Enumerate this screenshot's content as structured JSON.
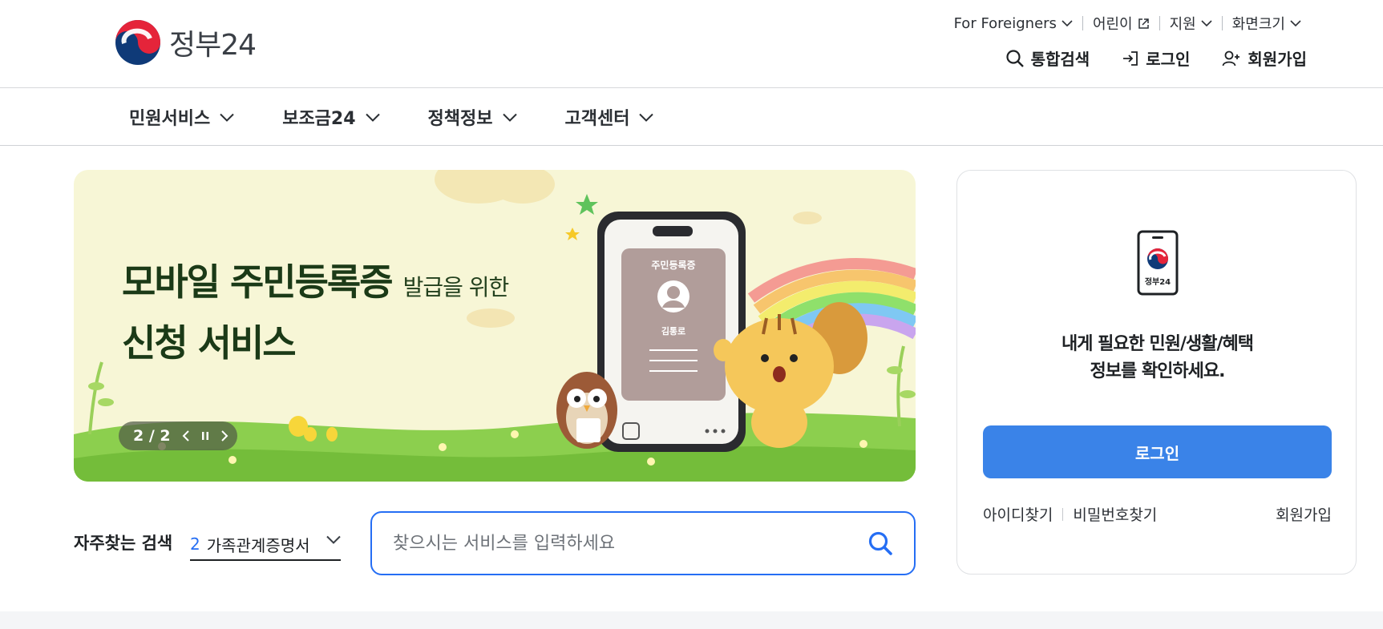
{
  "header": {
    "logo_text": "정부24",
    "util_links": [
      {
        "label": "For Foreigners",
        "icon": "chevron-down-icon"
      },
      {
        "label": "어린이",
        "icon": "external-link-icon"
      },
      {
        "label": "지원",
        "icon": "chevron-down-icon"
      },
      {
        "label": "화면크기",
        "icon": "chevron-down-icon"
      }
    ],
    "main_links": [
      {
        "label": "통합검색",
        "icon": "search-icon"
      },
      {
        "label": "로그인",
        "icon": "login-icon"
      },
      {
        "label": "회원가입",
        "icon": "user-add-icon"
      }
    ]
  },
  "gnb": {
    "items": [
      {
        "label": "민원서비스"
      },
      {
        "label": "보조금24"
      },
      {
        "label": "정책정보"
      },
      {
        "label": "고객센터"
      }
    ]
  },
  "banner": {
    "title_big": "모바일 주민등록증",
    "title_small": "발급을 위한",
    "title_line2": "신청 서비스",
    "card_title": "주민등록증",
    "card_name": "김통로",
    "pager": "2 / 2",
    "pager_current": 2,
    "pager_total": 2
  },
  "search": {
    "freq_label": "자주찾는 검색",
    "freq_rank": "2",
    "freq_value": "가족관계증명서",
    "placeholder": "찾으시는 서비스를 입력하세요"
  },
  "login_card": {
    "icon_caption": "정부24",
    "message_line1": "내게 필요한 민원/생활/혜택",
    "message_line2": "정보를 확인하세요.",
    "login_button": "로그인",
    "find_id": "아이디찾기",
    "find_pw": "비밀번호찾기",
    "signup": "회원가입"
  },
  "colors": {
    "primary": "#256ef4",
    "login_button": "#3a83e8",
    "banner_bg": "#f7f6d6",
    "banner_text": "#1b3a17"
  }
}
